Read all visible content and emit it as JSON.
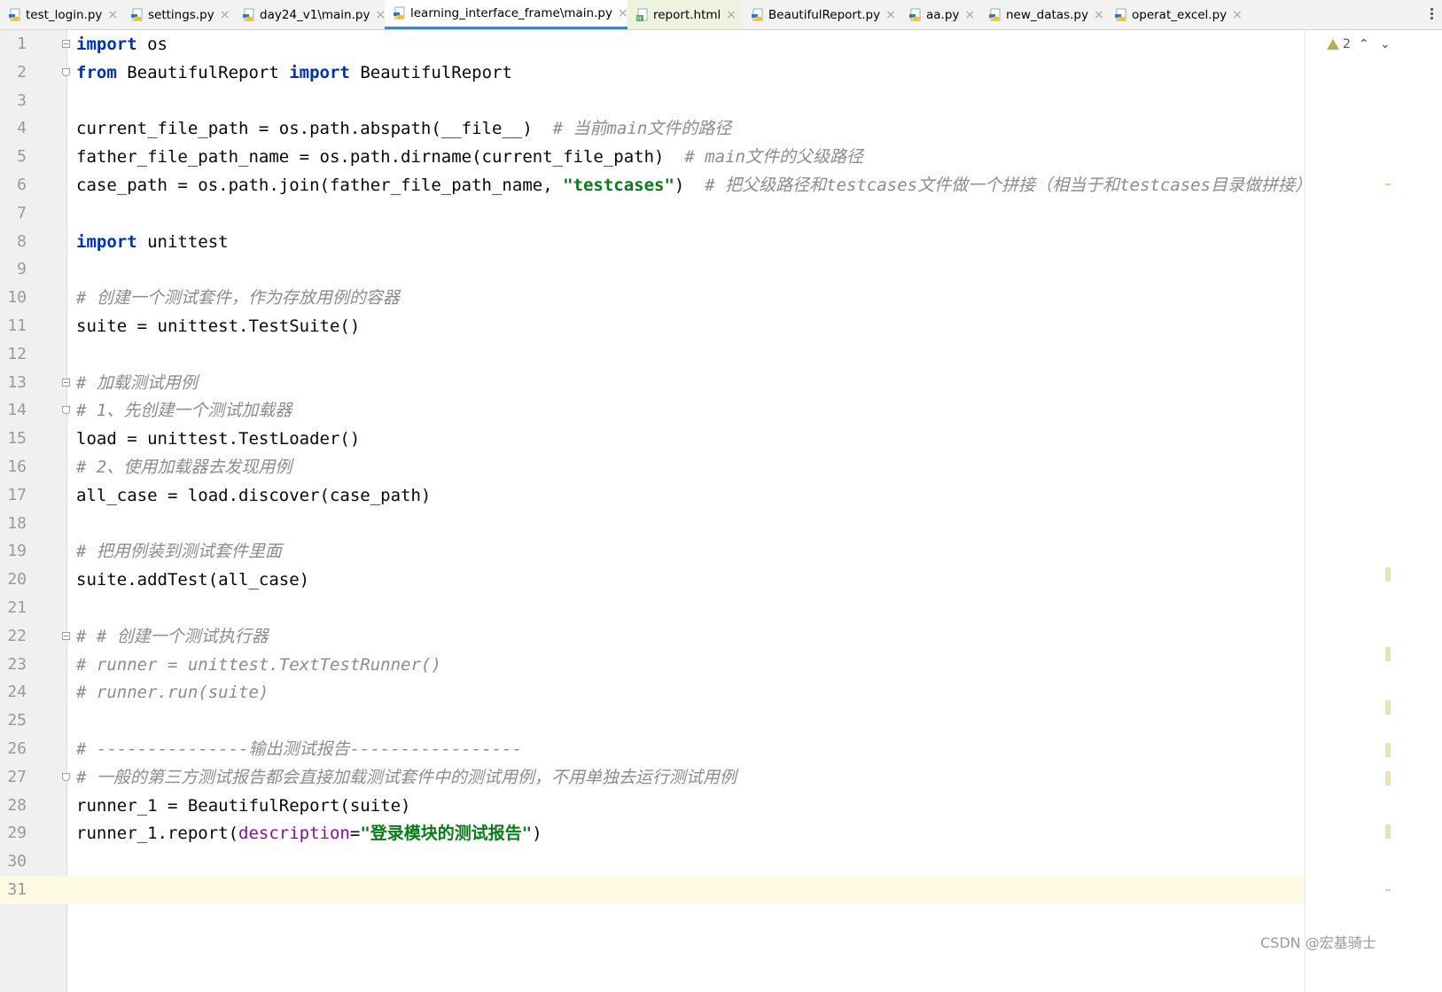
{
  "tabs": [
    {
      "label": "test_login.py",
      "icon": "python-file-icon"
    },
    {
      "label": "settings.py",
      "icon": "python-file-icon"
    },
    {
      "label": "day24_v1\\main.py",
      "icon": "python-file-icon"
    },
    {
      "label": "learning_interface_frame\\main.py",
      "icon": "python-file-icon",
      "active": true
    },
    {
      "label": "report.html",
      "icon": "html-file-icon"
    },
    {
      "label": "BeautifulReport.py",
      "icon": "python-file-icon"
    },
    {
      "label": "aa.py",
      "icon": "python-file-icon"
    },
    {
      "label": "new_datas.py",
      "icon": "python-file-icon"
    },
    {
      "label": "operat_excel.py",
      "icon": "python-file-icon"
    }
  ],
  "editor": {
    "line_numbers": [
      "1",
      "2",
      "3",
      "4",
      "5",
      "6",
      "7",
      "8",
      "9",
      "10",
      "11",
      "12",
      "13",
      "14",
      "15",
      "16",
      "17",
      "18",
      "19",
      "20",
      "21",
      "22",
      "23",
      "24",
      "25",
      "26",
      "27",
      "28",
      "29",
      "30",
      "31"
    ],
    "current_line": "31",
    "lines": [
      [
        {
          "t": "kw",
          "v": "import"
        },
        {
          "t": "n",
          "v": " os"
        }
      ],
      [
        {
          "t": "kw",
          "v": "from"
        },
        {
          "t": "n",
          "v": " BeautifulReport "
        },
        {
          "t": "kw",
          "v": "import"
        },
        {
          "t": "n",
          "v": " BeautifulReport"
        }
      ],
      [],
      [
        {
          "t": "n",
          "v": "current_file_path = os.path.abspath(__file__)  "
        },
        {
          "t": "cmt",
          "v": "# 当前main文件的路径"
        }
      ],
      [
        {
          "t": "n",
          "v": "father_file_path_name = os.path.dirname(current_file_path)  "
        },
        {
          "t": "cmt",
          "v": "# main文件的父级路径"
        }
      ],
      [
        {
          "t": "n",
          "v": "case_path = os.path.join(father_file_path_name, "
        },
        {
          "t": "str",
          "v": "\"testcases\""
        },
        {
          "t": "n",
          "v": ")  "
        },
        {
          "t": "cmt",
          "v": "# 把父级路径和testcases文件做一个拼接（相当于和testcases目录做拼接）"
        }
      ],
      [],
      [
        {
          "t": "kw",
          "v": "import"
        },
        {
          "t": "n",
          "v": " unittest"
        }
      ],
      [],
      [
        {
          "t": "cmt",
          "v": "# 创建一个测试套件，作为存放用例的容器"
        }
      ],
      [
        {
          "t": "n",
          "v": "suite = unittest.TestSuite()"
        }
      ],
      [],
      [
        {
          "t": "cmt",
          "v": "# 加载测试用例"
        }
      ],
      [
        {
          "t": "cmt",
          "v": "# 1、先创建一个测试加载器"
        }
      ],
      [
        {
          "t": "n",
          "v": "load = unittest.TestLoader()"
        }
      ],
      [
        {
          "t": "cmt",
          "v": "# 2、使用加载器去发现用例"
        }
      ],
      [
        {
          "t": "n",
          "v": "all_case = load.discover(case_path)"
        }
      ],
      [],
      [
        {
          "t": "cmt",
          "v": "# 把用例装到测试套件里面"
        }
      ],
      [
        {
          "t": "n",
          "v": "suite.addTest(all_case)"
        }
      ],
      [],
      [
        {
          "t": "cmt",
          "v": "# # 创建一个测试执行器"
        }
      ],
      [
        {
          "t": "cmt",
          "v": "# runner = unittest.TextTestRunner()"
        }
      ],
      [
        {
          "t": "cmt",
          "v": "# runner.run(suite)"
        }
      ],
      [],
      [
        {
          "t": "cmt",
          "v": "# ---------------输出测试报告-----------------"
        }
      ],
      [
        {
          "t": "cmt",
          "v": "# 一般的第三方测试报告都会直接加载测试套件中的测试用例，不用单独去运行测试用例"
        }
      ],
      [
        {
          "t": "n",
          "v": "runner_1 = BeautifulReport(suite)"
        }
      ],
      [
        {
          "t": "n",
          "v": "runner_1.report("
        },
        {
          "t": "param",
          "v": "description"
        },
        {
          "t": "n",
          "v": "="
        },
        {
          "t": "str",
          "v": "\"登录模块的测试报告\""
        },
        {
          "t": "n",
          "v": ")"
        }
      ],
      [],
      []
    ]
  },
  "inspections": {
    "warning_count": "2",
    "warning_icon": "warning-triangle-icon"
  },
  "watermark": "CSDN @宏基骑士",
  "colors": {
    "keyword": "#0033b3",
    "string": "#067d17",
    "comment": "#8c8c8c",
    "param": "#871094",
    "active_tab_underline": "#4083c9",
    "current_line_bg": "#fefae3"
  }
}
